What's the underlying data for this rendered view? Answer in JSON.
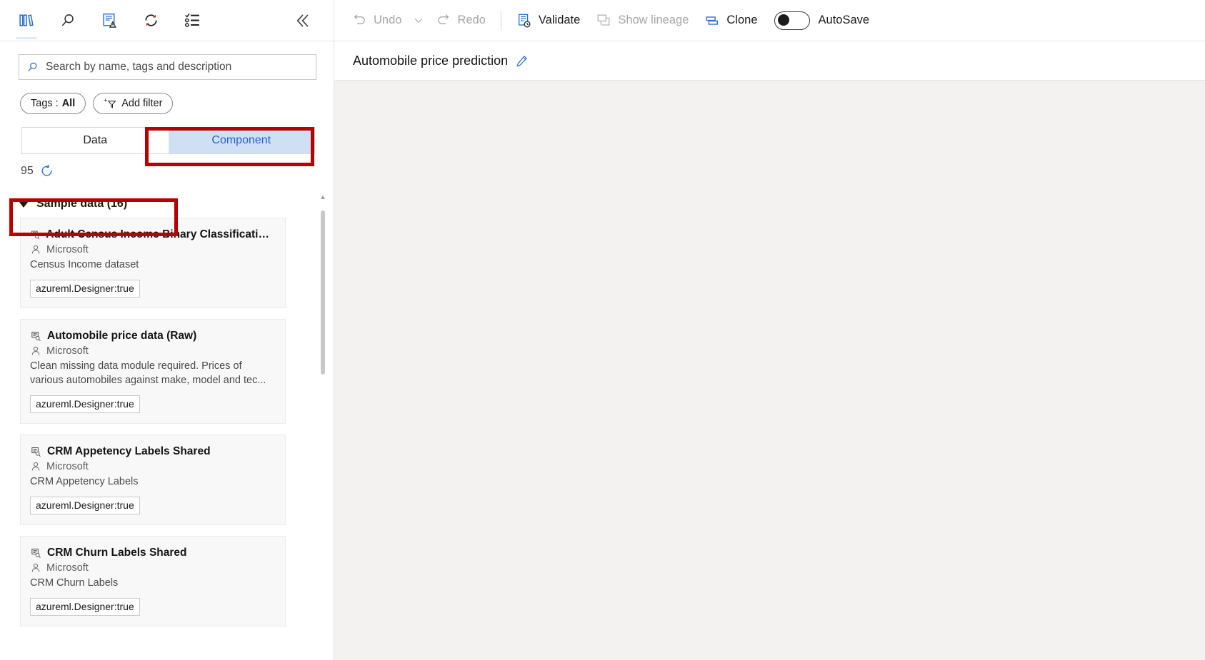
{
  "rail": {
    "items": [
      {
        "name": "asset-library-icon",
        "label": "Asset library",
        "active": true
      },
      {
        "name": "search-icon",
        "label": "Search",
        "active": false
      },
      {
        "name": "draft-notes-icon",
        "label": "Submitted jobs",
        "active": false
      },
      {
        "name": "refresh-sync-icon",
        "label": "Refresh",
        "active": false
      },
      {
        "name": "checklist-icon",
        "label": "Settings list",
        "active": false
      }
    ],
    "collapse_label": "Collapse panel"
  },
  "search": {
    "placeholder": "Search by name, tags and description",
    "value": "",
    "icon": "search-icon"
  },
  "filters": {
    "tags_label": "Tags : ",
    "tags_value": "All",
    "add_filter_label": "Add filter"
  },
  "type_toggle": {
    "options": [
      "Data",
      "Component"
    ],
    "selected": "Component"
  },
  "count": {
    "value": "95",
    "refresh_icon": "refresh-icon"
  },
  "group": {
    "label": "Sample data (16)",
    "expanded": true
  },
  "cards": [
    {
      "title": "Adult Census Income Binary Classification dat...",
      "owner": "Microsoft",
      "description": "Census Income dataset",
      "tag": "azureml.Designer:true"
    },
    {
      "title": "Automobile price data (Raw)",
      "owner": "Microsoft",
      "description": "Clean missing data module required. Prices of various automobiles against make, model and tec...",
      "tag": "azureml.Designer:true"
    },
    {
      "title": "CRM Appetency Labels Shared",
      "owner": "Microsoft",
      "description": "CRM Appetency Labels",
      "tag": "azureml.Designer:true"
    },
    {
      "title": "CRM Churn Labels Shared",
      "owner": "Microsoft",
      "description": "CRM Churn Labels",
      "tag": "azureml.Designer:true"
    }
  ],
  "toolbar": {
    "undo_label": "Undo",
    "redo_label": "Redo",
    "validate_label": "Validate",
    "show_lineage_label": "Show lineage",
    "clone_label": "Clone",
    "autosave_label": "AutoSave",
    "autosave_on": false
  },
  "title_bar": {
    "pipeline_name": "Automobile price prediction",
    "edit_icon": "pencil-icon"
  },
  "colors": {
    "accent_blue": "#0078d4",
    "selected_segment_bg": "#cfe0f5",
    "selected_segment_text": "#2563c9",
    "annotation_red": "#b90000",
    "canvas_bg": "#f3f2f1"
  }
}
